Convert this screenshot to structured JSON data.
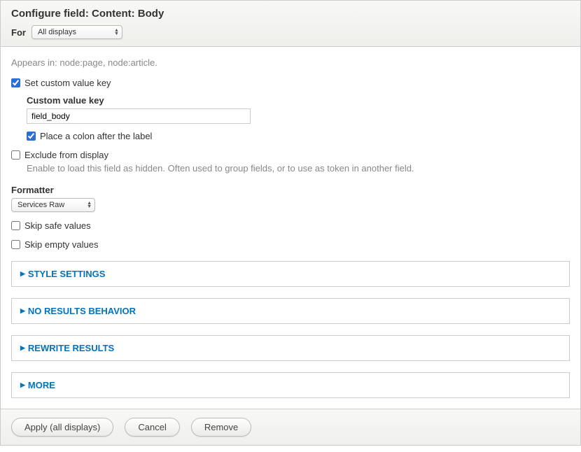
{
  "header": {
    "title": "Configure field: Content: Body",
    "for_label": "For",
    "for_select_value": "All displays"
  },
  "content": {
    "appears_in": "Appears in: node:page, node:article.",
    "set_custom_value_key": {
      "checked": true,
      "label": "Set custom value key"
    },
    "custom_value_key": {
      "label": "Custom value key",
      "value": "field_body"
    },
    "place_colon": {
      "checked": true,
      "label": "Place a colon after the label"
    },
    "exclude_from_display": {
      "checked": false,
      "label": "Exclude from display",
      "description": "Enable to load this field as hidden. Often used to group fields, or to use as token in another field."
    },
    "formatter": {
      "label": "Formatter",
      "value": "Services Raw"
    },
    "skip_safe_values": {
      "checked": false,
      "label": "Skip safe values"
    },
    "skip_empty_values": {
      "checked": false,
      "label": "Skip empty values"
    },
    "fieldsets": [
      {
        "label": "STYLE SETTINGS"
      },
      {
        "label": "NO RESULTS BEHAVIOR"
      },
      {
        "label": "REWRITE RESULTS"
      },
      {
        "label": "MORE"
      }
    ]
  },
  "footer": {
    "apply": "Apply (all displays)",
    "cancel": "Cancel",
    "remove": "Remove"
  }
}
